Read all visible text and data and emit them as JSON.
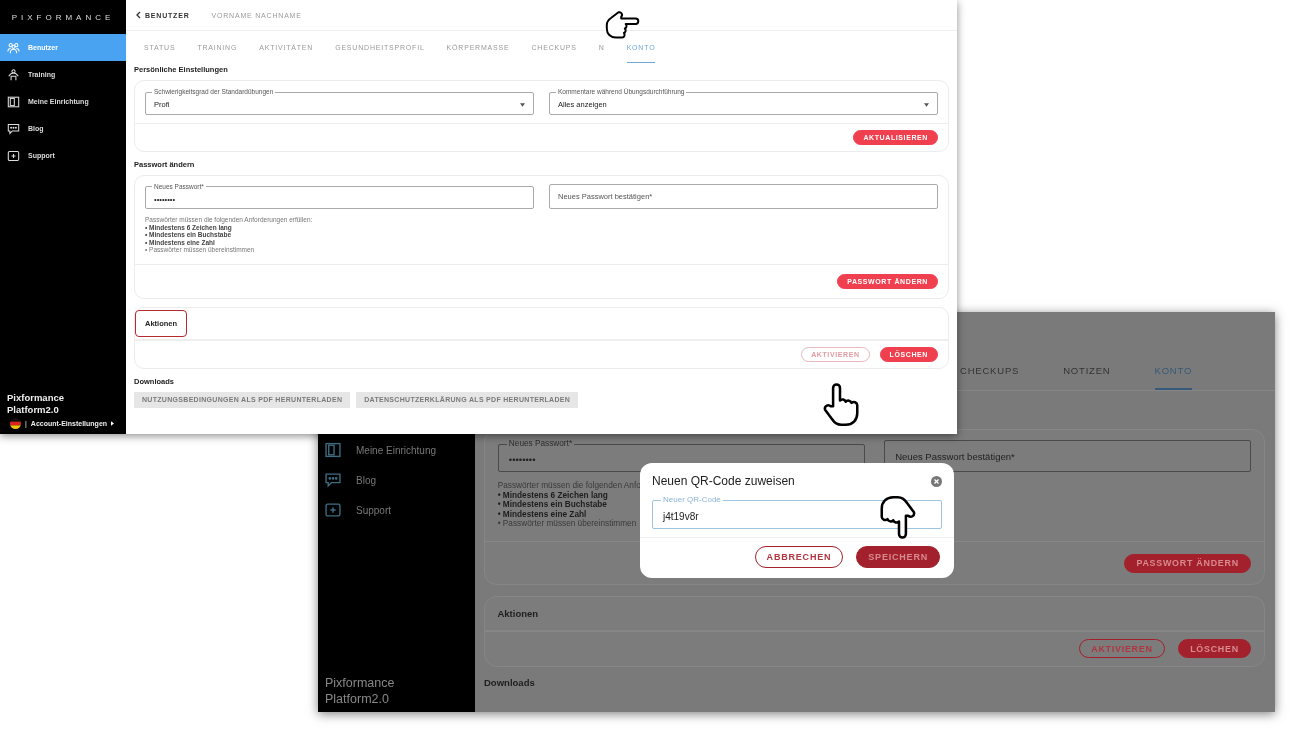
{
  "front_window": {
    "sidebar": {
      "logo": "PIXFORMANCE",
      "items": [
        {
          "label": "Benutzer",
          "selected": true
        },
        {
          "label": "Training",
          "selected": false
        },
        {
          "label": "Meine Einrichtung",
          "selected": false
        },
        {
          "label": "Blog",
          "selected": false
        },
        {
          "label": "Support",
          "selected": false
        }
      ],
      "brand": "Pixformance Platform2.0",
      "separator": "|",
      "account_link": "Account-Einstellungen"
    },
    "header": {
      "back_link": "BENUTZER",
      "user_name": "VORNAME NACHNAME"
    },
    "tabs": [
      {
        "label": "STATUS",
        "selected": false
      },
      {
        "label": "TRAINING",
        "selected": false
      },
      {
        "label": "AKTIVITÄTEN",
        "selected": false
      },
      {
        "label": "GESUNDHEITSPROFIL",
        "selected": false
      },
      {
        "label": "KÖRPERMASSE",
        "selected": false
      },
      {
        "label": "CHECKUPS",
        "selected": false
      },
      {
        "label": "N",
        "selected": false
      },
      {
        "label": "KONTO",
        "selected": true
      }
    ],
    "sections": [
      {
        "kind": "settings",
        "title": "Persönliche Einstellungen",
        "selects": [
          {
            "label": "Schwierigkeitsgrad der Standardübungen",
            "value": "Profi"
          },
          {
            "label": "Kommentare während Übungsdurchführung",
            "value": "Alles anzeigen"
          }
        ],
        "buttons": [
          {
            "label": "AKTUALISIEREN",
            "kind": "filled"
          }
        ]
      },
      {
        "kind": "password",
        "title": "Passwort ändern",
        "fields": [
          {
            "label": "Neues Passwort*",
            "value": "••••••••"
          },
          {
            "placeholder": "Neues Passwort bestätigen*"
          }
        ],
        "hints": [
          {
            "text": "Passwörter müssen die folgenden Anforderungen erfüllen:",
            "fulfilled": false
          },
          {
            "text": "• Mindestens 6 Zeichen lang",
            "fulfilled": true
          },
          {
            "text": "• Mindestens ein Buchstabe",
            "fulfilled": true
          },
          {
            "text": "• Mindestens eine Zahl",
            "fulfilled": true
          },
          {
            "text": "• Passwörter müssen übereinstimmen",
            "fulfilled": false
          }
        ],
        "buttons": [
          {
            "label": "PASSWORT ÄNDERN",
            "kind": "filled"
          }
        ]
      },
      {
        "kind": "actions",
        "title": "Aktionen",
        "highlighted": true,
        "buttons": [
          {
            "label": "AKTIVIEREN",
            "kind": "outline"
          },
          {
            "label": "LÖSCHEN",
            "kind": "filled"
          }
        ]
      },
      {
        "kind": "downloads",
        "title": "Downloads",
        "buttons": [
          {
            "label": "NUTZUNGSBEDINGUNGEN ALS PDF HERUNTERLADEN",
            "kind": "disabled"
          },
          {
            "label": "DATENSCHUTZERKLÄRUNG ALS PDF HERUNTERLADEN",
            "kind": "disabled"
          }
        ]
      }
    ]
  },
  "back_window": {
    "sidebar": {
      "items": [
        {
          "label": "Meine Einrichtung",
          "selected": false
        },
        {
          "label": "Blog",
          "selected": false
        },
        {
          "label": "Support",
          "selected": false
        }
      ],
      "brand": "Pixformance Platform2.0"
    },
    "tabs": [
      {
        "label": "CHECKUPS",
        "selected": false
      },
      {
        "label": "NOTIZEN",
        "selected": false
      },
      {
        "label": "KONTO",
        "selected": true
      }
    ],
    "sections": [
      {
        "kind": "password",
        "fields": [
          {
            "label": "Neues Passwort*",
            "value": "••••••••"
          },
          {
            "placeholder": "Neues Passwort bestätigen*"
          }
        ],
        "hints": [
          {
            "text": "Passwörter müssen die folgenden Anfo",
            "fulfilled": false
          },
          {
            "text": "• Mindestens 6 Zeichen lang",
            "fulfilled": true
          },
          {
            "text": "• Mindestens ein Buchstabe",
            "fulfilled": true
          },
          {
            "text": "• Mindestens eine Zahl",
            "fulfilled": true
          },
          {
            "text": "• Passwörter müssen übereinstimmen",
            "fulfilled": false
          }
        ],
        "buttons": [
          {
            "label": "PASSWORT ÄNDERN",
            "kind": "filled"
          }
        ]
      },
      {
        "kind": "actions",
        "title": "Aktionen",
        "buttons": [
          {
            "label": "AKTIVIEREN",
            "kind": "outline"
          },
          {
            "label": "LÖSCHEN",
            "kind": "filled"
          }
        ]
      },
      {
        "kind": "downloads",
        "title": "Downloads"
      }
    ],
    "modal": {
      "title": "Neuen QR-Code zuweisen",
      "field": {
        "label": "Neuer QR-Code",
        "value": "j4t19v8r"
      },
      "buttons": [
        {
          "label": "ABBRECHEN",
          "kind": "outline"
        },
        {
          "label": "SPEICHERN",
          "kind": "filled"
        }
      ]
    }
  }
}
